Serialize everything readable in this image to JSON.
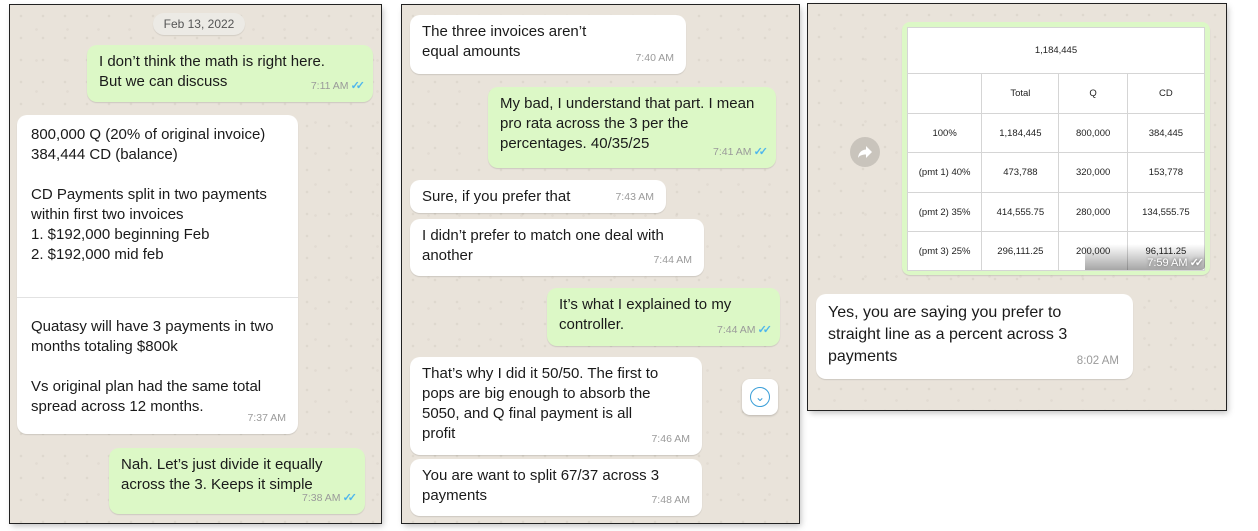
{
  "panel1": {
    "date": "Feb 13, 2022",
    "msg1": {
      "text": "I don’t think the math is right here.\nBut we can discuss",
      "time": "7:11 AM"
    },
    "msg2": {
      "part1": "800,000 Q (20% of original invoice)\n384,444 CD (balance)\n\nCD Payments split in two payments within first two invoices\n1. $192,000  beginning Feb\n2. $192,000 mid feb",
      "part2": "Quatasy will have 3 payments in two months totaling $800k\n\nVs original plan had the same total spread across 12 months.",
      "time": "7:37 AM"
    },
    "msg3": {
      "text": "Nah. Let’s just divide it equally across the 3. Keeps it simple",
      "time": "7:38 AM"
    }
  },
  "panel2": {
    "msg1": {
      "text": "The three invoices aren’t equal amounts",
      "time": "7:40 AM"
    },
    "msg2": {
      "text": "My bad, I understand that part. I mean pro rata across the 3 per the percentages. 40/35/25",
      "time": "7:41 AM"
    },
    "msg3": {
      "text": "Sure, if you prefer that",
      "time": "7:43 AM"
    },
    "msg4": {
      "text": "I didn’t prefer to match one deal with another",
      "time": "7:44 AM"
    },
    "msg5": {
      "text": "It’s what I explained to my controller.",
      "time": "7:44 AM"
    },
    "msg6": {
      "text": "That’s why I did it 50/50. The first to pops are big enough to absorb the 5050, and Q final payment is all profit",
      "time": "7:46 AM"
    },
    "msg7": {
      "text": "You are want to split 67/37 across 3 payments",
      "time": "7:48 AM"
    },
    "scroll_icon": "chevron-down-circle"
  },
  "panel3": {
    "table": {
      "title": "1,184,445",
      "headers": [
        "",
        "Total",
        "Q",
        "CD"
      ],
      "rows": [
        [
          "100%",
          "1,184,445",
          "800,000",
          "384,445"
        ],
        [
          "(pmt 1) 40%",
          "473,788",
          "320,000",
          "153,778"
        ],
        [
          "(pmt 2) 35%",
          "414,555.75",
          "280,000",
          "134,555.75"
        ],
        [
          "(pmt 3) 25%",
          "296,111.25",
          "200,000",
          "96,111.25"
        ]
      ]
    },
    "image_time": "7:59 AM",
    "forward_icon": "forward-arrow",
    "msg1": {
      "text": "Yes, you are saying you prefer to straight line as a percent across 3 payments",
      "time": "8:02 AM"
    }
  },
  "colors": {
    "wallpaper": "#e9e3da",
    "incoming": "#ffffff",
    "outgoing": "#dcf8c6",
    "read_ticks": "#4fb6ec"
  }
}
